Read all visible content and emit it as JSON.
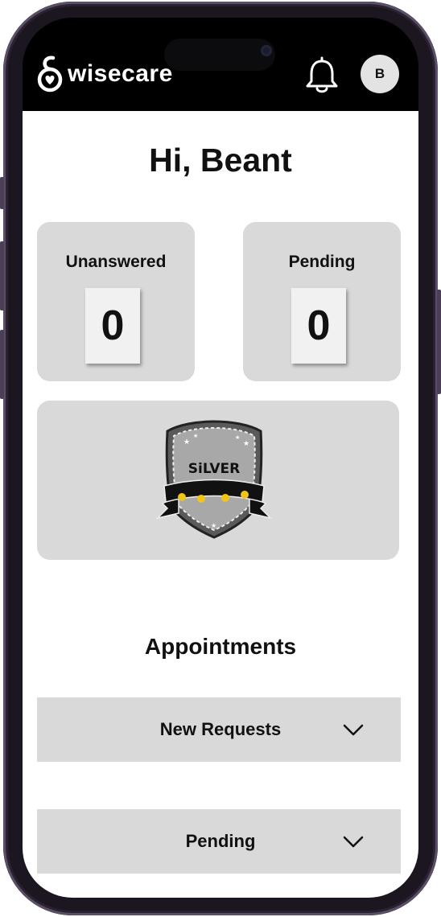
{
  "header": {
    "app_name": "wisecare",
    "logo_icon": "wisecare-logo-icon",
    "notification_icon": "bell-icon",
    "avatar_initial": "B"
  },
  "greeting": "Hi, Beant",
  "stats": [
    {
      "label": "Unanswered",
      "value": "0"
    },
    {
      "label": "Pending",
      "value": "0"
    }
  ],
  "badge": {
    "tier_text": "SiLVER",
    "icon": "silver-shield-badge-icon"
  },
  "appointments": {
    "title": "Appointments",
    "sections": [
      {
        "label": "New Requests",
        "icon": "chevron-down-icon"
      },
      {
        "label": "Pending",
        "icon": "chevron-down-icon"
      }
    ]
  },
  "colors": {
    "header_bg": "#000000",
    "card_bg": "#d9d9d9",
    "value_box_bg": "#f1f1f1",
    "avatar_bg": "#e3e3e3",
    "badge_gold": "#f2c417",
    "text": "#111111"
  }
}
